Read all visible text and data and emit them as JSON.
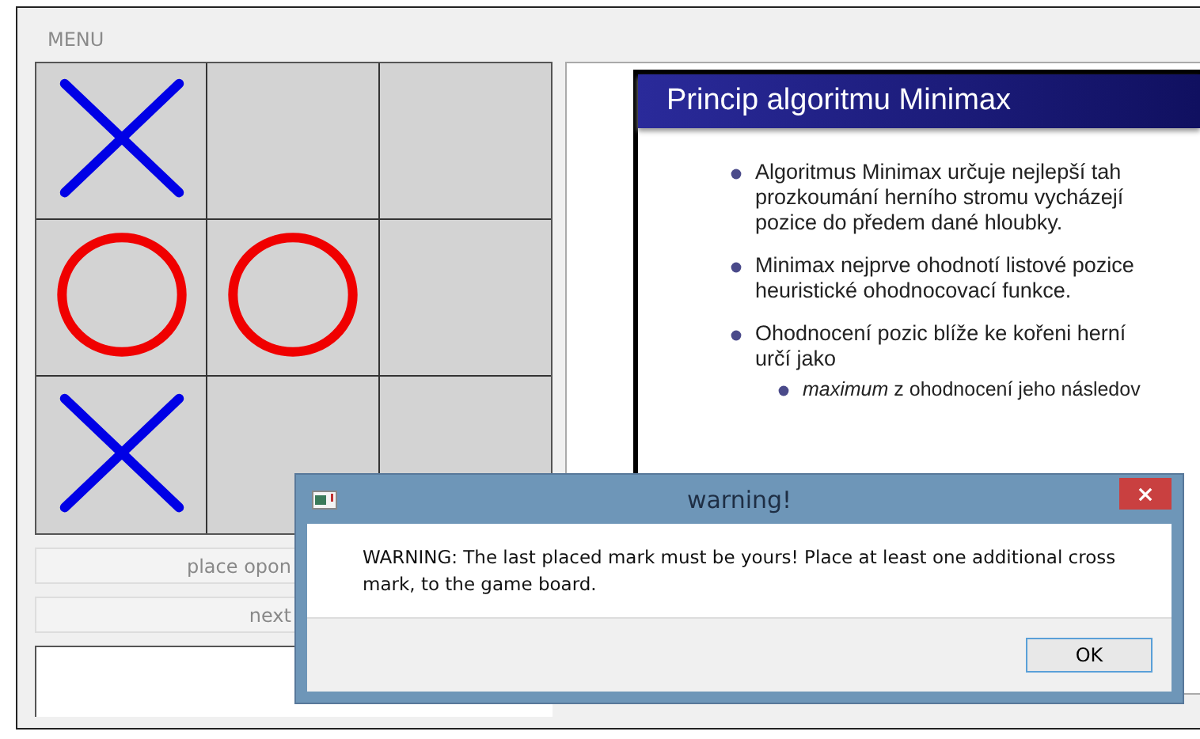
{
  "menu": {
    "label": "MENU"
  },
  "board": {
    "cells": [
      {
        "kind": "x"
      },
      {
        "kind": "empty"
      },
      {
        "kind": "empty"
      },
      {
        "kind": "o"
      },
      {
        "kind": "o"
      },
      {
        "kind": "empty"
      },
      {
        "kind": "x"
      },
      {
        "kind": "empty"
      },
      {
        "kind": "empty"
      }
    ]
  },
  "buttons": [
    "place opon",
    "next"
  ],
  "slide": {
    "title": "Princip algoritmu Minimax",
    "bullets": [
      {
        "kind": "main",
        "lines": [
          "Algoritmus Minimax určuje nejlepší tah",
          "prozkoumání herního stromu vycházejí",
          "pozice do předem dané hloubky."
        ]
      },
      {
        "kind": "main",
        "lines": [
          "Minimax nejprve ohodnotí listové pozice",
          "heuristické ohodnocovací funkce."
        ]
      },
      {
        "kind": "main",
        "lines": [
          "Ohodnocení pozic blíže ke kořeni herní",
          "určí jako"
        ]
      },
      {
        "kind": "sub",
        "lines": [
          "*maximum* z ohodnocení jeho následov"
        ]
      }
    ]
  },
  "dialog": {
    "title": "warning!",
    "message": "WARNING: The last placed mark must be yours! Place at least one additional cross mark, to the game board.",
    "button": "OK"
  }
}
